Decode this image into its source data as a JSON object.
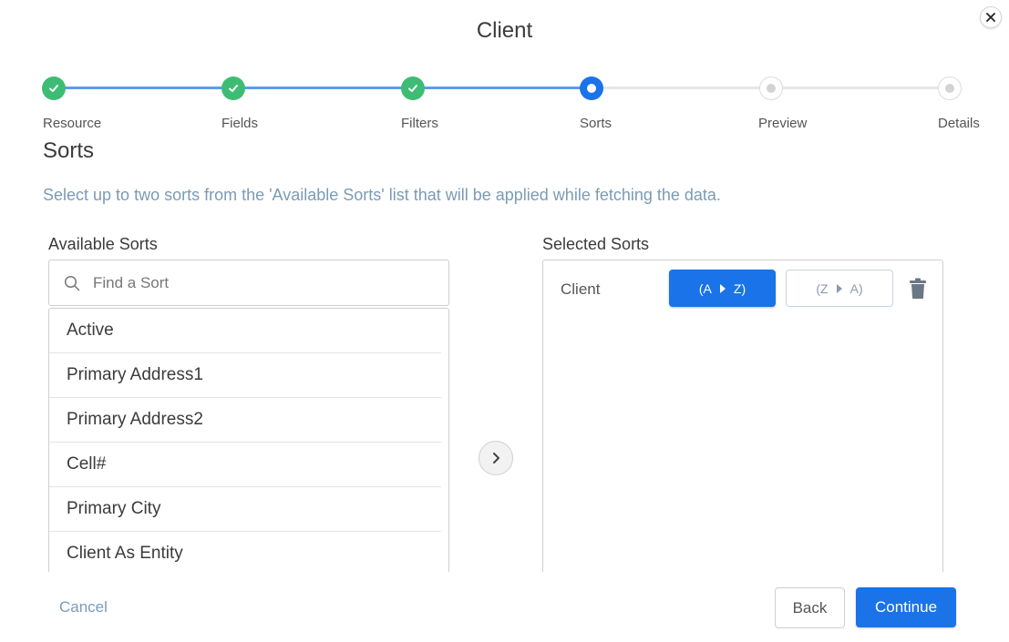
{
  "dialog": {
    "title": "Client"
  },
  "stepper": {
    "steps": [
      {
        "label": "Resource",
        "state": "done"
      },
      {
        "label": "Fields",
        "state": "done"
      },
      {
        "label": "Filters",
        "state": "done"
      },
      {
        "label": "Sorts",
        "state": "current"
      },
      {
        "label": "Preview",
        "state": "todo"
      },
      {
        "label": "Details",
        "state": "todo"
      }
    ]
  },
  "section": {
    "title": "Sorts",
    "instruction": "Select up to two sorts from the 'Available Sorts' list that will be applied while fetching the data."
  },
  "available": {
    "label": "Available Sorts",
    "search_placeholder": "Find a Sort",
    "items": [
      "Active",
      "Primary Address1",
      "Primary Address2",
      "Cell#",
      "Primary City",
      "Client As Entity"
    ]
  },
  "selected": {
    "label": "Selected Sorts",
    "items": [
      {
        "name": "Client",
        "asc_from": "(A",
        "asc_to": "Z)",
        "desc_from": "(Z",
        "desc_to": "A)",
        "direction": "asc"
      }
    ]
  },
  "footer": {
    "cancel_label": "Cancel",
    "back_label": "Back",
    "continue_label": "Continue"
  },
  "colors": {
    "accent": "#1a73e8",
    "done": "#3dbd74",
    "line_done": "#5b9bf0",
    "muted": "#7a9bb5"
  },
  "icons": {
    "close": "close-icon",
    "search": "search-icon",
    "move": "chevron-right-icon",
    "delete": "trash-icon",
    "check": "check-icon"
  }
}
